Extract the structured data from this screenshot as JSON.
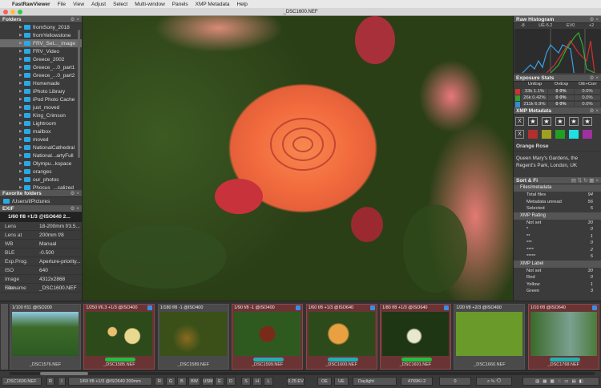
{
  "menubar": {
    "apple": "",
    "app": "FastRawViewer",
    "items": [
      "File",
      "View",
      "Adjust",
      "Select",
      "Multi-window",
      "Panels",
      "XMP Metadata",
      "Help"
    ]
  },
  "window": {
    "title": "_DSC1600.NEF"
  },
  "folders": {
    "title": "Folders",
    "items": [
      "fromSony_2018",
      "fromYellowstone",
      "FRV_Set..._image",
      "FRV_Video",
      "Greece_2002",
      "Greece_...0_part1",
      "Greece_...0_part2",
      "Homemade",
      "iPhoto Library",
      "iPod Photo Cache",
      "just_moved",
      "King_Crimson",
      "Lightroom",
      "mailbox",
      "moved",
      "NationalCathedral",
      "National...artyFull",
      "Olympu...kspace",
      "oranges",
      "our_photos",
      "Phocus_...calized"
    ],
    "selected_index": 2
  },
  "favorites": {
    "title": "Favorite folders",
    "items": [
      "/Users/l/Pictures"
    ]
  },
  "exif": {
    "title": "EXIF",
    "summary": "1/60 f/8 +1/3 @ISO640 2...",
    "rows": [
      [
        "Lens",
        "18-200mm f/3.5..."
      ],
      [
        "Lens at",
        "200mm f/8"
      ],
      [
        "WB",
        "Manual"
      ],
      [
        "BLE",
        "-0.500"
      ],
      [
        "Exp.Prog.",
        "Aperture-priority..."
      ],
      [
        "ISO",
        "640"
      ],
      [
        "Image Size",
        "4312x2868"
      ],
      [
        "Filename",
        "_DSC1600.NEF"
      ]
    ]
  },
  "histogram": {
    "title": "Raw Histogram",
    "scale": [
      "-8",
      "UE-5.2",
      "EV0",
      "+2"
    ]
  },
  "exposure": {
    "title": "Exposure Stats",
    "headers": [
      "UnExp",
      "OvExp",
      "OE+Corr"
    ],
    "rows": [
      {
        "color": "#d03030",
        "unexp": "33k 1.1%",
        "ovexp": "0 0%",
        "corr": "0.0%"
      },
      {
        "color": "#30a030",
        "unexp": "26k 0.42%",
        "ovexp": "0 0%",
        "corr": "0.0%"
      },
      {
        "color": "#3090d0",
        "unexp": "211k 6.9%",
        "ovexp": "0 0%",
        "corr": "0.0%"
      }
    ]
  },
  "xmp": {
    "title": "XMP Metadata",
    "label_colors": [
      "#b03030",
      "#a0a020",
      "#20a020",
      "#20e0e0",
      "#a030a0"
    ],
    "title_text": "Orange Rose",
    "description": "Queen Mary's Gardens, the Regent's Park, London, UK"
  },
  "sort": {
    "title": "Sort & Fi",
    "sections": [
      {
        "name": "Files/metadata",
        "rows": [
          [
            "Total files",
            "94"
          ],
          [
            "Metadata unread",
            "56"
          ],
          [
            "Selected",
            "5"
          ]
        ]
      },
      {
        "name": "XMP Rating",
        "rows": [
          [
            "Not set",
            "30"
          ],
          [
            "*",
            "0"
          ],
          [
            "**",
            "1"
          ],
          [
            "***",
            "0"
          ],
          [
            "****",
            "2"
          ],
          [
            "*****",
            "5"
          ]
        ]
      },
      {
        "name": "XMP Label",
        "rows": [
          [
            "Not set",
            "30"
          ],
          [
            "Red",
            "0"
          ],
          [
            "Yellow",
            "1"
          ],
          [
            "Green",
            "3"
          ]
        ]
      }
    ]
  },
  "filmstrip": [
    {
      "cap": "1/100 f/11  @ISO200",
      "file": "_DSC1576.NEF",
      "sel": false,
      "chk": false,
      "label": "",
      "bg": "linear-gradient(#8fc8e0 0%,#3d6a2a 35%,#2c5a22 100%)"
    },
    {
      "cap": "1/250 f/6.3 +1/3 @ISO400",
      "file": "_DSC1585.NEF",
      "sel": true,
      "chk": true,
      "label": "#20c040",
      "bg": "radial-gradient(circle at 70% 55%,#e8d890 0,#e8d890 14%,transparent 16%),radial-gradient(circle at 40% 45%,#e8c070 0,#e8c070 9%,transparent 11%),#2d4a1a"
    },
    {
      "cap": "1/180 f/8 -1 @ISO400",
      "file": "_DSC1589.NEF",
      "sel": false,
      "chk": false,
      "label": "",
      "bg": "radial-gradient(circle at 40% 60%,#8a6a20,transparent 30%),#3a5018"
    },
    {
      "cap": "1/90 f/8 -1 @ISO400",
      "file": "_DSC1599.NEF",
      "sel": true,
      "chk": true,
      "label": "#20b0b0",
      "bg": "radial-gradient(circle at 50% 50%,#7a2a1a 0,#7a2a1a 18%,transparent 22%),#2e5a20"
    },
    {
      "cap": "1/60 f/8 +1/3 @ISO640",
      "file": "_DSC1600.NEF",
      "sel": true,
      "chk": true,
      "label": "#20b0b0",
      "bg": "radial-gradient(circle at 45% 50%,#e8a040 0,#e8a040 22%,transparent 26%),#2d4a1a"
    },
    {
      "cap": "1/80 f/8 +1/3 @ISO640",
      "file": "_DSC1601.NEF",
      "sel": true,
      "chk": true,
      "label": "#20c040",
      "bg": "radial-gradient(circle at 48% 55%,#e8e8d0 0,#e8e8d0 15%,transparent 19%),#1f3614"
    },
    {
      "cap": "1/20 f/8 +2/3 @ISO400",
      "file": "_DSC1660.NEF",
      "sel": false,
      "chk": false,
      "label": "",
      "bg": "#6a9a2a"
    },
    {
      "cap": "1/10 f/8  @ISO640",
      "file": "_DSC1768.NEF",
      "sel": true,
      "chk": true,
      "label": "#20b0b0",
      "bg": "linear-gradient(90deg,#3a6a2a,#7aa090 60%,#4a7a3a)"
    }
  ],
  "status": {
    "file": "_DSC1600.NEF",
    "buttons": [
      "R",
      "I"
    ],
    "exif": "1/60 f/8 +1/3 @ISO640 200mm",
    "channels": [
      "R",
      "G",
      "B",
      "BW",
      "USM",
      "E",
      "D",
      "S",
      "H",
      "L"
    ],
    "ev": "0.25 EV",
    "oe": "OE",
    "ue": "UE",
    "wb": "Daylight",
    "temp": "4769K/-2",
    "tint": "0"
  }
}
